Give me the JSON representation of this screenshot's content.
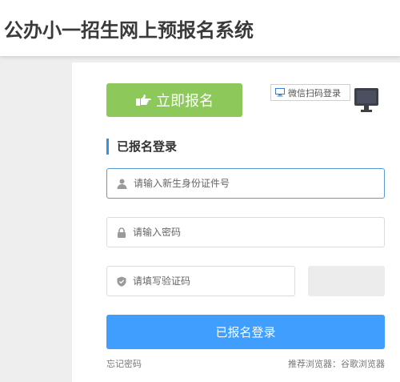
{
  "header": {
    "title": "公办小一招生网上预报名系统"
  },
  "register_button": {
    "label": "立即报名",
    "color": "#8cc85a"
  },
  "wechat_login": {
    "label": "微信扫码登录"
  },
  "login_section": {
    "title": "已报名登录",
    "accent": "#3a8ee6"
  },
  "form": {
    "id_placeholder": "请输入新生身份证件号",
    "password_placeholder": "请输入密码",
    "captcha_placeholder": "请填写验证码"
  },
  "login_button": {
    "label": "已报名登录",
    "color": "#409eff"
  },
  "footer": {
    "forgot_password": "忘记密码",
    "browser_tip": "推荐浏览器：谷歌浏览器"
  },
  "icons": [
    "hand-pointer-icon",
    "monitor-icon",
    "qr-toggle-icon",
    "user-icon",
    "lock-icon",
    "shield-icon"
  ]
}
